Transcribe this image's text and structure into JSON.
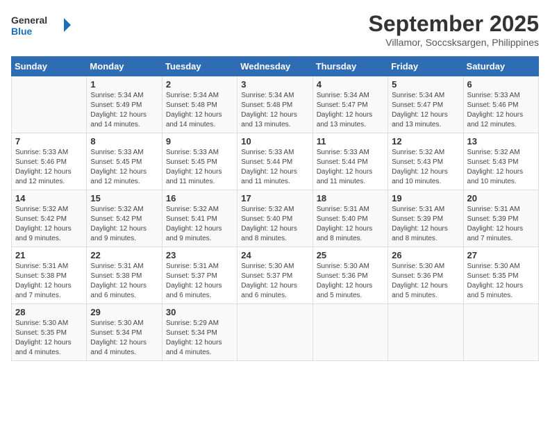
{
  "header": {
    "logo_line1": "General",
    "logo_line2": "Blue",
    "month_year": "September 2025",
    "location": "Villamor, Soccsksargen, Philippines"
  },
  "days_of_week": [
    "Sunday",
    "Monday",
    "Tuesday",
    "Wednesday",
    "Thursday",
    "Friday",
    "Saturday"
  ],
  "weeks": [
    [
      {
        "day": "",
        "info": ""
      },
      {
        "day": "1",
        "info": "Sunrise: 5:34 AM\nSunset: 5:49 PM\nDaylight: 12 hours\nand 14 minutes."
      },
      {
        "day": "2",
        "info": "Sunrise: 5:34 AM\nSunset: 5:48 PM\nDaylight: 12 hours\nand 14 minutes."
      },
      {
        "day": "3",
        "info": "Sunrise: 5:34 AM\nSunset: 5:48 PM\nDaylight: 12 hours\nand 13 minutes."
      },
      {
        "day": "4",
        "info": "Sunrise: 5:34 AM\nSunset: 5:47 PM\nDaylight: 12 hours\nand 13 minutes."
      },
      {
        "day": "5",
        "info": "Sunrise: 5:34 AM\nSunset: 5:47 PM\nDaylight: 12 hours\nand 13 minutes."
      },
      {
        "day": "6",
        "info": "Sunrise: 5:33 AM\nSunset: 5:46 PM\nDaylight: 12 hours\nand 12 minutes."
      }
    ],
    [
      {
        "day": "7",
        "info": "Sunrise: 5:33 AM\nSunset: 5:46 PM\nDaylight: 12 hours\nand 12 minutes."
      },
      {
        "day": "8",
        "info": "Sunrise: 5:33 AM\nSunset: 5:45 PM\nDaylight: 12 hours\nand 12 minutes."
      },
      {
        "day": "9",
        "info": "Sunrise: 5:33 AM\nSunset: 5:45 PM\nDaylight: 12 hours\nand 11 minutes."
      },
      {
        "day": "10",
        "info": "Sunrise: 5:33 AM\nSunset: 5:44 PM\nDaylight: 12 hours\nand 11 minutes."
      },
      {
        "day": "11",
        "info": "Sunrise: 5:33 AM\nSunset: 5:44 PM\nDaylight: 12 hours\nand 11 minutes."
      },
      {
        "day": "12",
        "info": "Sunrise: 5:32 AM\nSunset: 5:43 PM\nDaylight: 12 hours\nand 10 minutes."
      },
      {
        "day": "13",
        "info": "Sunrise: 5:32 AM\nSunset: 5:43 PM\nDaylight: 12 hours\nand 10 minutes."
      }
    ],
    [
      {
        "day": "14",
        "info": "Sunrise: 5:32 AM\nSunset: 5:42 PM\nDaylight: 12 hours\nand 9 minutes."
      },
      {
        "day": "15",
        "info": "Sunrise: 5:32 AM\nSunset: 5:42 PM\nDaylight: 12 hours\nand 9 minutes."
      },
      {
        "day": "16",
        "info": "Sunrise: 5:32 AM\nSunset: 5:41 PM\nDaylight: 12 hours\nand 9 minutes."
      },
      {
        "day": "17",
        "info": "Sunrise: 5:32 AM\nSunset: 5:40 PM\nDaylight: 12 hours\nand 8 minutes."
      },
      {
        "day": "18",
        "info": "Sunrise: 5:31 AM\nSunset: 5:40 PM\nDaylight: 12 hours\nand 8 minutes."
      },
      {
        "day": "19",
        "info": "Sunrise: 5:31 AM\nSunset: 5:39 PM\nDaylight: 12 hours\nand 8 minutes."
      },
      {
        "day": "20",
        "info": "Sunrise: 5:31 AM\nSunset: 5:39 PM\nDaylight: 12 hours\nand 7 minutes."
      }
    ],
    [
      {
        "day": "21",
        "info": "Sunrise: 5:31 AM\nSunset: 5:38 PM\nDaylight: 12 hours\nand 7 minutes."
      },
      {
        "day": "22",
        "info": "Sunrise: 5:31 AM\nSunset: 5:38 PM\nDaylight: 12 hours\nand 6 minutes."
      },
      {
        "day": "23",
        "info": "Sunrise: 5:31 AM\nSunset: 5:37 PM\nDaylight: 12 hours\nand 6 minutes."
      },
      {
        "day": "24",
        "info": "Sunrise: 5:30 AM\nSunset: 5:37 PM\nDaylight: 12 hours\nand 6 minutes."
      },
      {
        "day": "25",
        "info": "Sunrise: 5:30 AM\nSunset: 5:36 PM\nDaylight: 12 hours\nand 5 minutes."
      },
      {
        "day": "26",
        "info": "Sunrise: 5:30 AM\nSunset: 5:36 PM\nDaylight: 12 hours\nand 5 minutes."
      },
      {
        "day": "27",
        "info": "Sunrise: 5:30 AM\nSunset: 5:35 PM\nDaylight: 12 hours\nand 5 minutes."
      }
    ],
    [
      {
        "day": "28",
        "info": "Sunrise: 5:30 AM\nSunset: 5:35 PM\nDaylight: 12 hours\nand 4 minutes."
      },
      {
        "day": "29",
        "info": "Sunrise: 5:30 AM\nSunset: 5:34 PM\nDaylight: 12 hours\nand 4 minutes."
      },
      {
        "day": "30",
        "info": "Sunrise: 5:29 AM\nSunset: 5:34 PM\nDaylight: 12 hours\nand 4 minutes."
      },
      {
        "day": "",
        "info": ""
      },
      {
        "day": "",
        "info": ""
      },
      {
        "day": "",
        "info": ""
      },
      {
        "day": "",
        "info": ""
      }
    ]
  ]
}
